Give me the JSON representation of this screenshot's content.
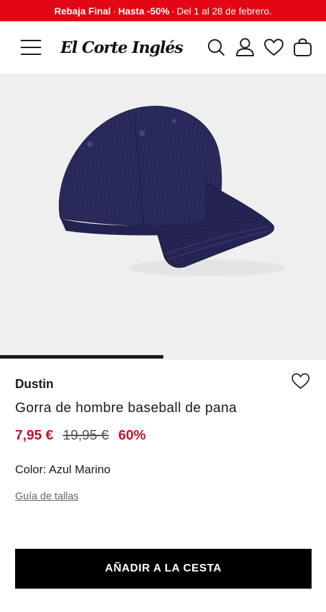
{
  "promo": {
    "part1": "Rebaja Final",
    "part2": "Hasta -50%",
    "part3": "Del 1 al 28 de febrero.",
    "separator": "·"
  },
  "header": {
    "logo_text": "El Corte Inglés",
    "icons": [
      "menu-icon",
      "search-icon",
      "user-icon",
      "heart-icon",
      "bag-icon"
    ]
  },
  "gallery": {
    "image_alt": "navy corduroy baseball cap",
    "progress": 0.5
  },
  "product": {
    "brand": "Dustin",
    "title": "Gorra de hombre baseball de pana",
    "price_current": "7,95 €",
    "price_original": "19,95 €",
    "discount": "60%",
    "color_label": "Color:",
    "color_value": "Azul Marino",
    "size_guide": "Guía de tallas"
  },
  "cta": {
    "add_to_cart": "AÑADIR A LA CESTA"
  },
  "colors": {
    "promo_bg": "#e30613",
    "price_red": "#c8102e",
    "cap_navy": "#2b2b5e"
  }
}
